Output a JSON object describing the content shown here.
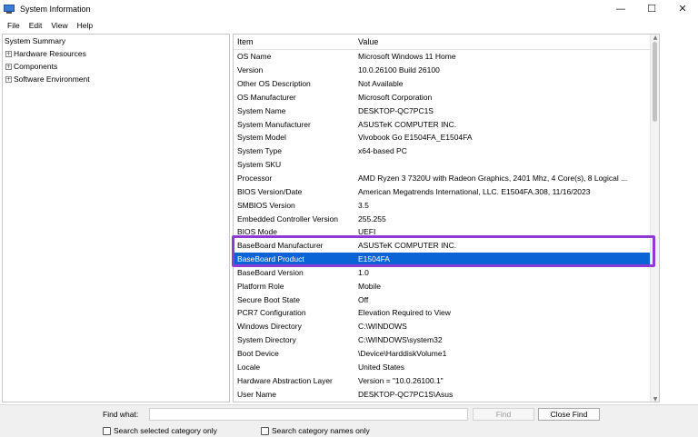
{
  "window": {
    "title": "System Information",
    "minimize_glyph": "—",
    "maximize_glyph": "☐",
    "close_glyph": "✕"
  },
  "menu": [
    "File",
    "Edit",
    "View",
    "Help"
  ],
  "tree": {
    "root": "System Summary",
    "children": [
      {
        "label": "Hardware Resources",
        "expander": "+"
      },
      {
        "label": "Components",
        "expander": "+"
      },
      {
        "label": "Software Environment",
        "expander": "+"
      }
    ]
  },
  "table": {
    "headers": {
      "item": "Item",
      "value": "Value"
    },
    "rows": [
      {
        "item": "OS Name",
        "value": "Microsoft Windows 11 Home"
      },
      {
        "item": "Version",
        "value": "10.0.26100 Build 26100"
      },
      {
        "item": "Other OS Description",
        "value": "Not Available"
      },
      {
        "item": "OS Manufacturer",
        "value": "Microsoft Corporation"
      },
      {
        "item": "System Name",
        "value": "DESKTOP-QC7PC1S"
      },
      {
        "item": "System Manufacturer",
        "value": "ASUSTeK COMPUTER INC."
      },
      {
        "item": "System Model",
        "value": "Vivobook Go E1504FA_E1504FA"
      },
      {
        "item": "System Type",
        "value": "x64-based PC"
      },
      {
        "item": "System SKU",
        "value": ""
      },
      {
        "item": "Processor",
        "value": "AMD Ryzen 3 7320U with Radeon Graphics, 2401 Mhz, 4 Core(s), 8 Logical ..."
      },
      {
        "item": "BIOS Version/Date",
        "value": "American Megatrends International, LLC. E1504FA.308, 11/16/2023"
      },
      {
        "item": "SMBIOS Version",
        "value": "3.5"
      },
      {
        "item": "Embedded Controller Version",
        "value": "255.255"
      },
      {
        "item": "BIOS Mode",
        "value": "UEFI"
      },
      {
        "item": "BaseBoard Manufacturer",
        "value": "ASUSTeK COMPUTER INC."
      },
      {
        "item": "BaseBoard Product",
        "value": "E1504FA"
      },
      {
        "item": "BaseBoard Version",
        "value": "1.0"
      },
      {
        "item": "Platform Role",
        "value": "Mobile"
      },
      {
        "item": "Secure Boot State",
        "value": "Off"
      },
      {
        "item": "PCR7 Configuration",
        "value": "Elevation Required to View"
      },
      {
        "item": "Windows Directory",
        "value": "C:\\WINDOWS"
      },
      {
        "item": "System Directory",
        "value": "C:\\WINDOWS\\system32"
      },
      {
        "item": "Boot Device",
        "value": "\\Device\\HarddiskVolume1"
      },
      {
        "item": "Locale",
        "value": "United States"
      },
      {
        "item": "Hardware Abstraction Layer",
        "value": "Version = \"10.0.26100.1\""
      },
      {
        "item": "User Name",
        "value": "DESKTOP-QC7PC1S\\Asus"
      }
    ],
    "selected_row": 15
  },
  "find": {
    "label": "Find what:",
    "value": "",
    "find_button": "Find",
    "close_button": "Close Find",
    "check_selected": "Search selected category only",
    "check_names": "Search category names only"
  },
  "colors": {
    "selection": "#0a64d6",
    "highlight_border": "#8e3bd6"
  }
}
